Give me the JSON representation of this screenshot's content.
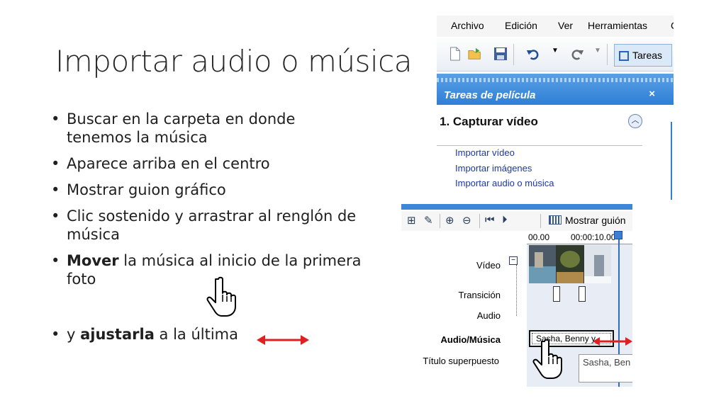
{
  "slide": {
    "title": "Importar audio o música",
    "bullets": [
      "Buscar en la carpeta en donde tenemos la música",
      "Aparece arriba en el centro",
      "Mostrar guion gráfico",
      "Clic sostenido y arrastrar al renglón de música"
    ],
    "bullet_move": {
      "bold": "Mover",
      "rest": " la música al inicio de la primera foto"
    },
    "bullet_adjust": {
      "prefix": "y ",
      "bold": "ajustarla",
      "rest": " a la última"
    }
  },
  "screenshot_menu": {
    "menu": [
      "Archivo",
      "Edición",
      "Ver",
      "Herramientas",
      "C"
    ],
    "toolbar": {
      "icons": [
        "new-file-icon",
        "open-folder-icon",
        "save-icon",
        "undo-icon",
        "redo-icon"
      ],
      "tareas_label": "Tareas"
    },
    "taskpane_title": "Tareas de película",
    "taskpane_close": "×",
    "section_title": "1. Capturar vídeo",
    "links": [
      "Importar vídeo",
      "Importar imágenes",
      "Importar audio o música"
    ]
  },
  "screenshot_timeline": {
    "storyboard_label": "Mostrar guión",
    "ruler": [
      "00.00",
      "00:00:10.00"
    ],
    "tracks": {
      "video": "Vídeo",
      "transition": "Transición",
      "audio": "Audio",
      "audio_music": "Audio/Música",
      "title_overlay": "Título superpuesto"
    },
    "music_clip": "Sasha, Benny y",
    "tooltip": "Sasha, Ben"
  },
  "colors": {
    "accent_blue": "#2f7fd6",
    "arrow_red": "#e02020",
    "link_blue": "#1d36a8"
  }
}
